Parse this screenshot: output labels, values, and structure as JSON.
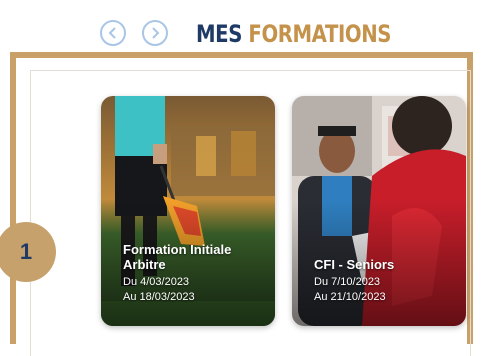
{
  "header": {
    "title_part1": "MES",
    "title_part2": "FORMATIONS",
    "prev_icon": "chevron-left-icon",
    "next_icon": "chevron-right-icon"
  },
  "step": {
    "number": "1"
  },
  "cards": [
    {
      "title": "Formation Initiale Arbitre",
      "date_from": "Du 4/03/2023",
      "date_to": "Au 18/03/2023"
    },
    {
      "title": "CFI - Seniors",
      "date_from": "Du 7/10/2023",
      "date_to": "Au 21/10/2023"
    }
  ],
  "colors": {
    "navy": "#1f3a66",
    "gold": "#c4924a",
    "frame": "#c9a068",
    "nav_border": "#a9c6e6"
  }
}
